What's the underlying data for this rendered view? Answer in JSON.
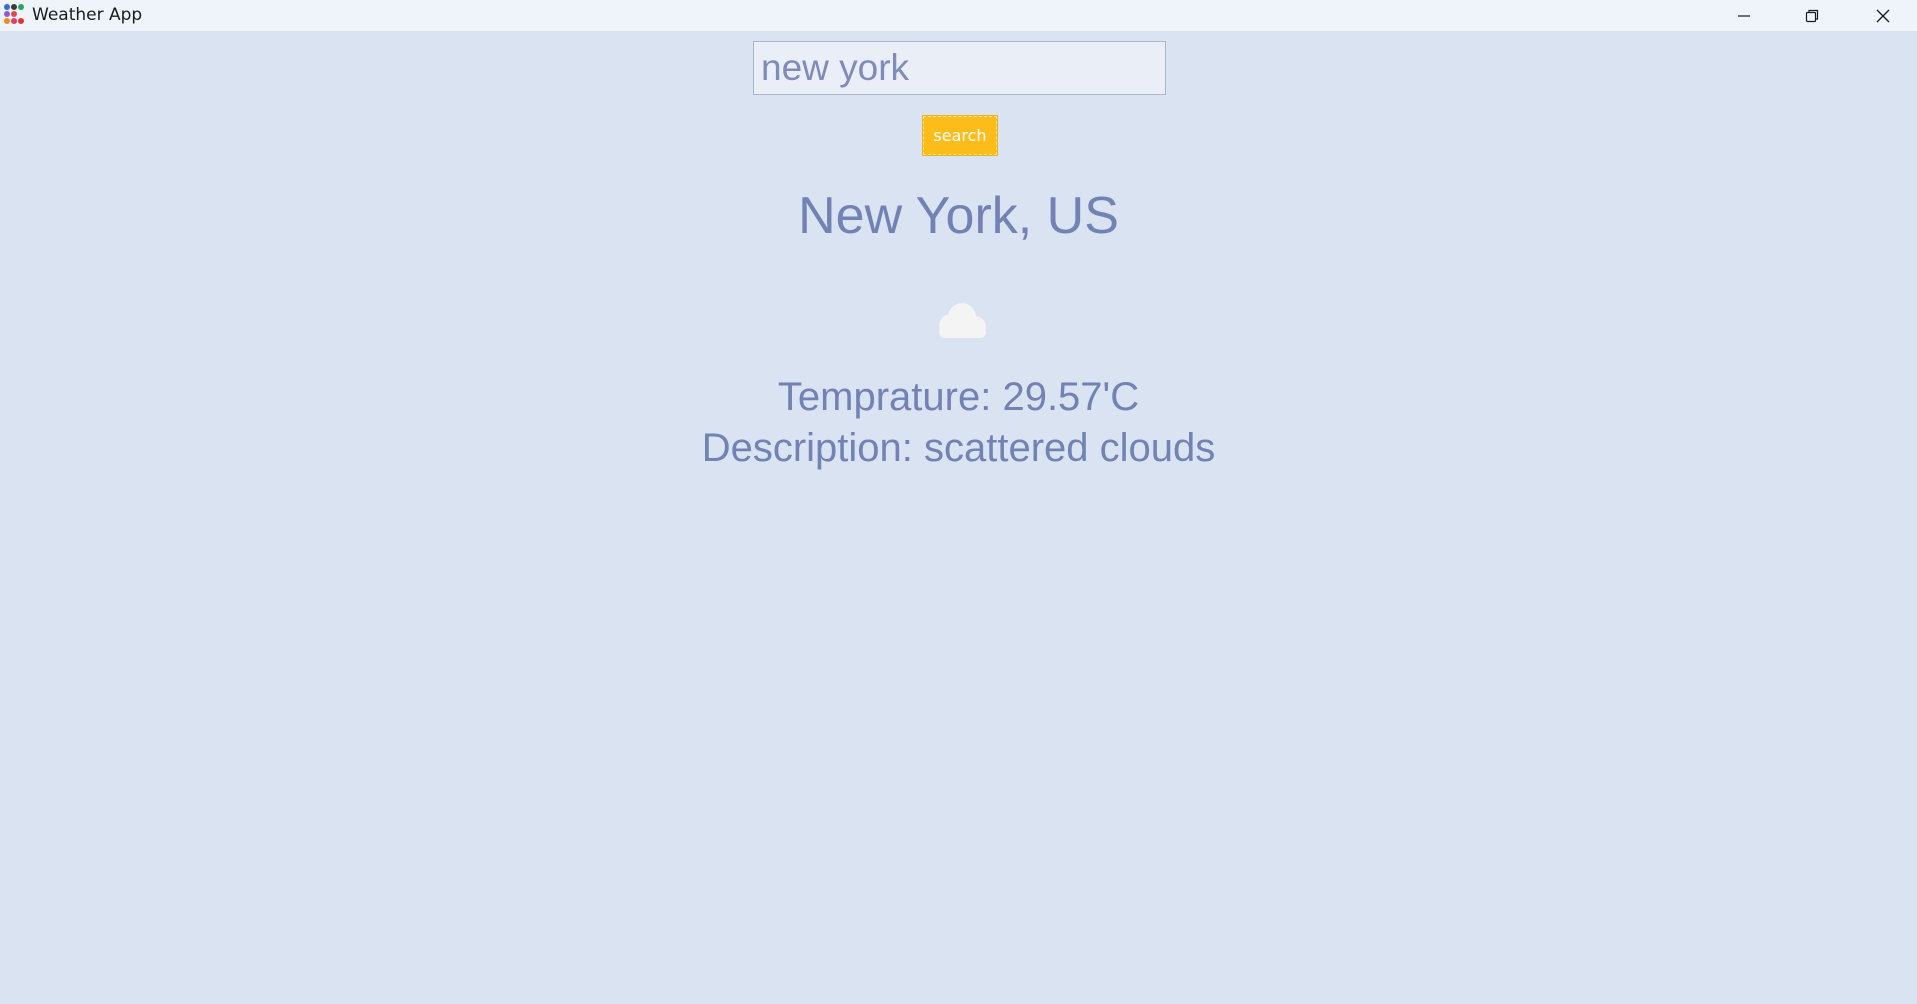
{
  "window": {
    "title": "Weather App",
    "controls": {
      "minimize_icon": "minimize-icon",
      "maximize_icon": "restore-icon",
      "close_icon": "close-icon"
    }
  },
  "search": {
    "value": "new york",
    "button_label": "search"
  },
  "weather": {
    "location": "New York, US",
    "icon": "cloud-icon",
    "temperature_text": "Temprature: 29.57'C",
    "description_text": "Description: scattered clouds"
  },
  "colors": {
    "background": "#dae3f1",
    "text": "#7382b4",
    "button": "#fcbc1a"
  }
}
